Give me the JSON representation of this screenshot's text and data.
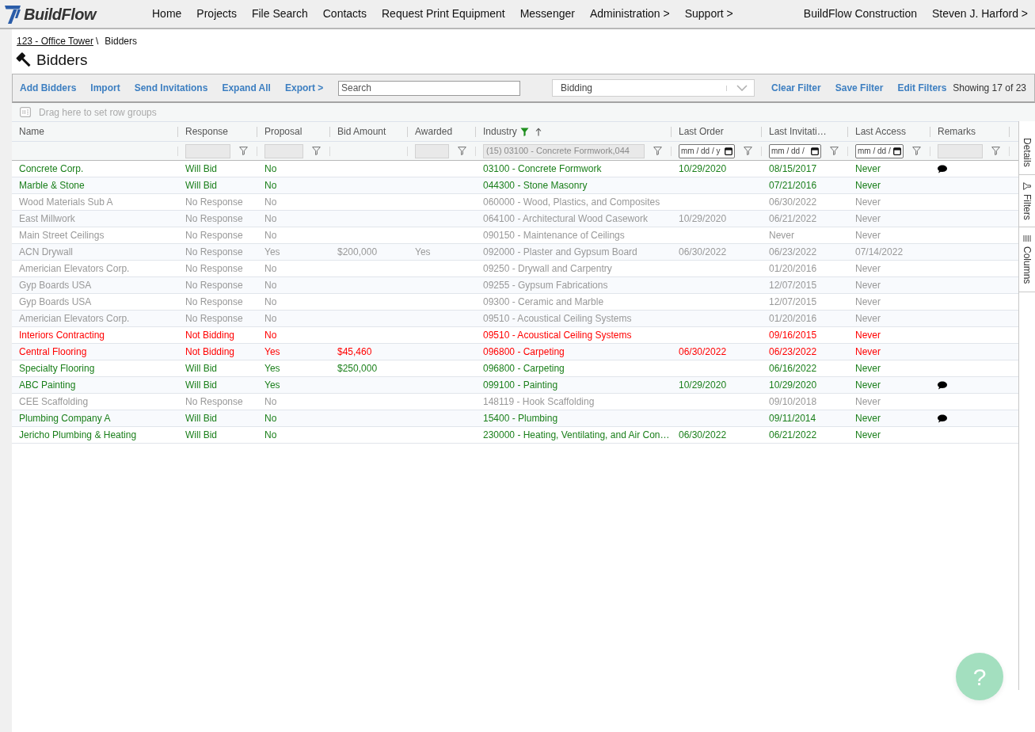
{
  "nav": {
    "logo": "BuildFlow",
    "items": [
      "Home",
      "Projects",
      "File Search",
      "Contacts",
      "Request Print Equipment",
      "Messenger",
      "Administration >",
      "Support >"
    ],
    "company": "BuildFlow Construction",
    "user": "Steven J. Harford >"
  },
  "breadcrumb": {
    "link": "123 - Office Tower",
    "separator": "\\",
    "current": "Bidders"
  },
  "page_title": "Bidders",
  "toolbar": {
    "actions": [
      "Add Bidders",
      "Import",
      "Send Invitations",
      "Expand All",
      "Export >"
    ],
    "search": {
      "placeholder": "Search"
    },
    "filter_select": {
      "value": "Bidding"
    },
    "filter_actions": [
      "Clear Filter",
      "Save Filter",
      "Edit Filters"
    ],
    "count": "Showing 17 of 23"
  },
  "row_groups": {
    "hint": "Drag here to set row groups"
  },
  "table": {
    "columns": [
      {
        "label": "Name",
        "filtered": false,
        "sorted": false
      },
      {
        "label": "Response",
        "filtered": false,
        "sorted": false,
        "filter": {
          "kind": "text"
        }
      },
      {
        "label": "Proposal",
        "filtered": false,
        "sorted": false,
        "filter": {
          "kind": "text"
        }
      },
      {
        "label": "Bid Amount",
        "filtered": false,
        "sorted": false
      },
      {
        "label": "Awarded",
        "filtered": false,
        "sorted": false,
        "filter": {
          "kind": "text"
        }
      },
      {
        "label": "Industry",
        "filtered": true,
        "sorted": true,
        "filter": {
          "kind": "text",
          "value": "(15) 03100 - Concrete Formwork,044"
        }
      },
      {
        "label": "Last Order",
        "filtered": false,
        "sorted": false,
        "filter": {
          "kind": "date",
          "placeholder": "mm / dd / y"
        }
      },
      {
        "label": "Last Invitati…",
        "filtered": false,
        "sorted": false,
        "filter": {
          "kind": "date",
          "placeholder": "mm / dd /"
        }
      },
      {
        "label": "Last Access",
        "filtered": false,
        "sorted": false,
        "filter": {
          "kind": "date",
          "placeholder": "mm / dd /"
        }
      },
      {
        "label": "Remarks",
        "filtered": false,
        "sorted": false,
        "filter": {
          "kind": "text"
        }
      }
    ],
    "rows": [
      {
        "name": "Concrete Corp.",
        "response": "Will Bid",
        "proposal": "No",
        "industry": "03100 - Concrete Formwork",
        "last_order": "10/29/2020",
        "last_invitation": "08/15/2017",
        "last_access": "Never",
        "remark": true,
        "color": "#1a7f1a"
      },
      {
        "name": "Marble & Stone",
        "response": "Will Bid",
        "proposal": "No",
        "industry": "044300 - Stone Masonry",
        "last_invitation": "07/21/2016",
        "last_access": "Never",
        "remark": false,
        "color": "#1a7f1a"
      },
      {
        "name": "Wood Materials Sub A",
        "response": "No Response",
        "proposal": "No",
        "industry": "060000 - Wood, Plastics, and Composites",
        "last_invitation": "06/30/2022",
        "last_access": "Never",
        "remark": false,
        "color": "#999999"
      },
      {
        "name": "East Millwork",
        "response": "No Response",
        "proposal": "No",
        "industry": "064100 - Architectural Wood Casework",
        "last_order": "10/29/2020",
        "last_invitation": "06/21/2022",
        "last_access": "Never",
        "remark": false,
        "color": "#999999"
      },
      {
        "name": "Main Street Ceilings",
        "response": "No Response",
        "proposal": "No",
        "industry": "090150 - Maintenance of Ceilings",
        "last_invitation": "Never",
        "last_access": "Never",
        "remark": false,
        "color": "#999999"
      },
      {
        "name": "ACN Drywall",
        "response": "No Response",
        "proposal": "Yes",
        "bid_amount": "$200,000",
        "awarded": "Yes",
        "industry": "092000 - Plaster and Gypsum Board",
        "last_order": "06/30/2022",
        "last_invitation": "06/23/2022",
        "last_access": "07/14/2022",
        "remark": false,
        "color": "#999999"
      },
      {
        "name": "Americian Elevators Corp.",
        "response": "No Response",
        "proposal": "No",
        "industry": "09250 - Drywall and Carpentry",
        "last_invitation": "01/20/2016",
        "last_access": "Never",
        "remark": false,
        "color": "#999999"
      },
      {
        "name": "Gyp Boards USA",
        "response": "No Response",
        "proposal": "No",
        "industry": "09255 - Gypsum Fabrications",
        "last_invitation": "12/07/2015",
        "last_access": "Never",
        "remark": false,
        "color": "#999999"
      },
      {
        "name": "Gyp Boards USA",
        "response": "No Response",
        "proposal": "No",
        "industry": "09300 - Ceramic and Marble",
        "last_invitation": "12/07/2015",
        "last_access": "Never",
        "remark": false,
        "color": "#999999"
      },
      {
        "name": "Americian Elevators Corp.",
        "response": "No Response",
        "proposal": "No",
        "industry": "09510 - Acoustical Ceiling Systems",
        "last_invitation": "01/20/2016",
        "last_access": "Never",
        "remark": false,
        "color": "#999999"
      },
      {
        "name": "Interiors Contracting",
        "response": "Not Bidding",
        "proposal": "No",
        "industry": "09510 - Acoustical Ceiling Systems",
        "last_invitation": "09/16/2015",
        "last_access": "Never",
        "remark": false,
        "color": "#ff0000"
      },
      {
        "name": "Central Flooring",
        "response": "Not Bidding",
        "proposal": "Yes",
        "bid_amount": "$45,460",
        "industry": "096800 - Carpeting",
        "last_order": "06/30/2022",
        "last_invitation": "06/23/2022",
        "last_access": "Never",
        "remark": false,
        "color": "#ff0000"
      },
      {
        "name": "Specialty Flooring",
        "response": "Will Bid",
        "proposal": "Yes",
        "bid_amount": "$250,000",
        "industry": "096800 - Carpeting",
        "last_invitation": "06/16/2022",
        "last_access": "Never",
        "remark": false,
        "color": "#1a7f1a"
      },
      {
        "name": "ABC Painting",
        "response": "Will Bid",
        "proposal": "Yes",
        "industry": "099100 - Painting",
        "last_order": "10/29/2020",
        "last_invitation": "10/29/2020",
        "last_access": "Never",
        "remark": true,
        "color": "#1a7f1a"
      },
      {
        "name": "CEE Scaffolding",
        "response": "No Response",
        "proposal": "No",
        "industry": "148119 - Hook Scaffolding",
        "last_invitation": "09/10/2018",
        "last_access": "Never",
        "remark": false,
        "color": "#999999"
      },
      {
        "name": "Plumbing Company A",
        "response": "Will Bid",
        "proposal": "No",
        "industry": "15400 - Plumbing",
        "last_invitation": "09/11/2014",
        "last_access": "Never",
        "remark": true,
        "color": "#1a7f1a"
      },
      {
        "name": "Jericho Plumbing & Heating",
        "response": "Will Bid",
        "proposal": "No",
        "industry": "230000 - Heating, Ventilating, and Air Con…",
        "last_order": "06/30/2022",
        "last_invitation": "06/21/2022",
        "last_access": "Never",
        "remark": false,
        "color": "#1a7f1a"
      }
    ]
  },
  "side_tabs": [
    "Details",
    "Filters",
    "Columns"
  ],
  "help_button": {
    "label": "?"
  }
}
